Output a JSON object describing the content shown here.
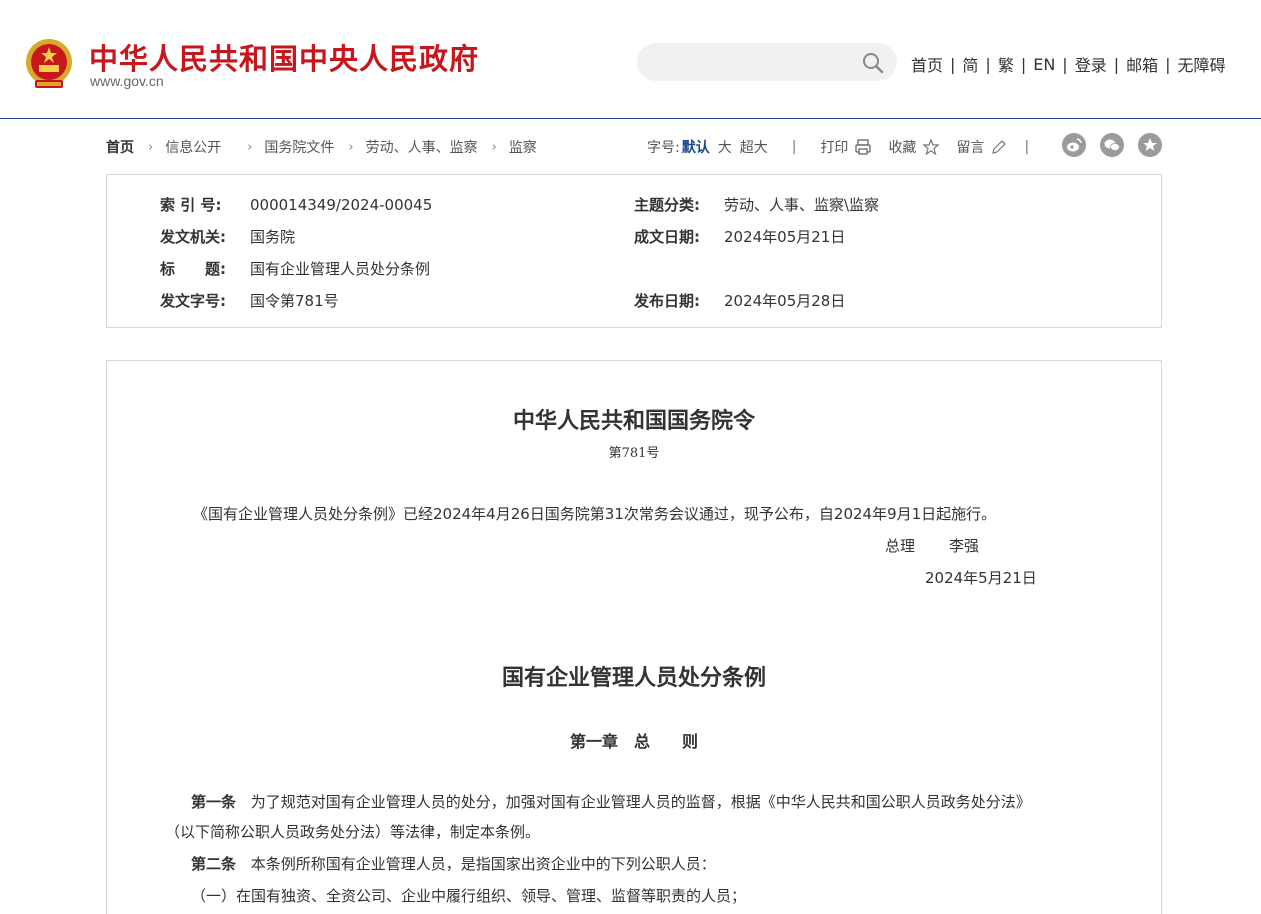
{
  "header": {
    "site_title": "中华人民共和国中央人民政府",
    "site_domain": "www.gov.cn",
    "search": {
      "placeholder": ""
    },
    "nav": [
      {
        "label": "首页"
      },
      {
        "label": "简"
      },
      {
        "label": "繁"
      },
      {
        "label": "EN"
      },
      {
        "label": "登录"
      },
      {
        "label": "邮箱"
      },
      {
        "label": "无障碍"
      }
    ]
  },
  "breadcrumb": {
    "home": "首页",
    "items": [
      "信息公开",
      "国务院文件",
      "劳动、人事、监察",
      "监察"
    ]
  },
  "toolbar": {
    "font_size_label": "字号:",
    "font_default": "默认",
    "font_large": "大",
    "font_xlarge": "超大",
    "print": "打印",
    "favorite": "收藏",
    "comment": "留言"
  },
  "meta": {
    "index_no_label": "索 引 号:",
    "index_no": "000014349/2024-00045",
    "subject_label": "主题分类:",
    "subject": "劳动、人事、监察\\监察",
    "issuer_label": "发文机关:",
    "issuer": "国务院",
    "written_date_label": "成文日期:",
    "written_date": "2024年05月21日",
    "title_label": "标　　题:",
    "title": "国有企业管理人员处分条例",
    "doc_no_label": "发文字号:",
    "doc_no": "国令第781号",
    "publish_date_label": "发布日期:",
    "publish_date": "2024年05月28日"
  },
  "document": {
    "order_title": "中华人民共和国国务院令",
    "order_no": "第781号",
    "intro": "《国有企业管理人员处分条例》已经2024年4月26日国务院第31次常务会议通过，现予公布，自2024年9月1日起施行。",
    "premier_label": "总理",
    "premier_name": "李强",
    "sign_date": "2024年5月21日",
    "regulation_title": "国有企业管理人员处分条例",
    "chapter_title": "第一章　总　　则",
    "art1_label": "第一条",
    "art1_text": "为了规范对国有企业管理人员的处分，加强对国有企业管理人员的监督，根据《中华人民共和国公职人员政务处分法》",
    "art1_cont": "（以下简称公职人员政务处分法）等法律，制定本条例。",
    "art2_label": "第二条",
    "art2_text": "本条例所称国有企业管理人员，是指国家出资企业中的下列公职人员：",
    "item1": "（一）在国有独资、全资公司、企业中履行组织、领导、管理、监督等职责的人员；"
  }
}
